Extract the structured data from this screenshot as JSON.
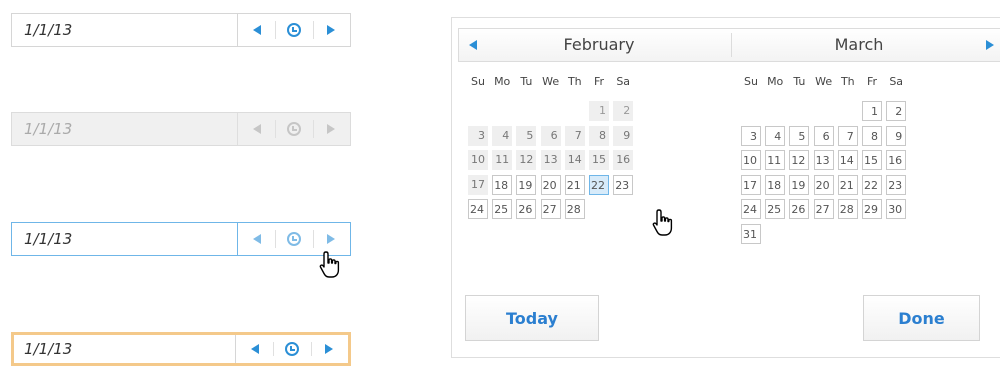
{
  "inputs": [
    {
      "state": "normal",
      "value": "1/1/13"
    },
    {
      "state": "disabled",
      "value": "1/1/13"
    },
    {
      "state": "hover",
      "value": "1/1/13"
    },
    {
      "state": "focus",
      "value": "1/1/13"
    }
  ],
  "calendar": {
    "weekdays": [
      "Su",
      "Mo",
      "Tu",
      "We",
      "Th",
      "Fr",
      "Sa"
    ],
    "months": [
      {
        "name": "February",
        "weeks": [
          [
            "",
            "",
            "",
            "",
            "",
            "1",
            "2"
          ],
          [
            "3",
            "4",
            "5",
            "6",
            "7",
            "8",
            "9"
          ],
          [
            "10",
            "11",
            "12",
            "13",
            "14",
            "15",
            "16"
          ],
          [
            "17",
            "18",
            "19",
            "20",
            "21",
            "22",
            "23"
          ],
          [
            "24",
            "25",
            "26",
            "27",
            "28",
            "",
            ""
          ]
        ]
      },
      {
        "name": "March",
        "weeks": [
          [
            "",
            "",
            "",
            "",
            "",
            "1",
            "2"
          ],
          [
            "3",
            "4",
            "5",
            "6",
            "7",
            "8",
            "9"
          ],
          [
            "10",
            "11",
            "12",
            "13",
            "14",
            "15",
            "16"
          ],
          [
            "17",
            "18",
            "19",
            "20",
            "21",
            "22",
            "23"
          ],
          [
            "24",
            "25",
            "26",
            "27",
            "28",
            "29",
            "30"
          ],
          [
            "31",
            "",
            "",
            "",
            "",
            "",
            ""
          ]
        ]
      }
    ],
    "today_label": "Today",
    "done_label": "Done"
  },
  "colors": {
    "accent": "#2b8fd6",
    "hover_border": "#6fb6e8",
    "focus_border": "#f4c98a",
    "disabled_bg": "#f0f0f0",
    "past_day_bg": "#efefef",
    "hover_day_bg": "#d7ebfa"
  }
}
